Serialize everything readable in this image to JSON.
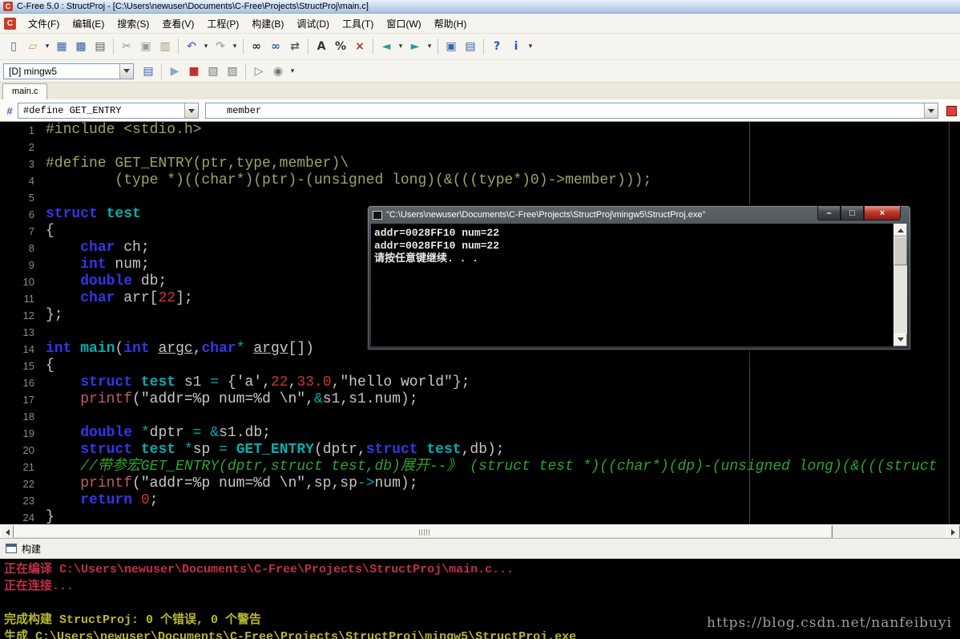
{
  "window": {
    "title": "C-Free 5.0 : StructProj - [C:\\Users\\newuser\\Documents\\C-Free\\Projects\\StructProj\\main.c]",
    "app_icon": "C"
  },
  "menu": {
    "items": [
      {
        "key": "file",
        "label": "文件(F)"
      },
      {
        "key": "edit",
        "label": "编辑(E)"
      },
      {
        "key": "search",
        "label": "搜索(S)"
      },
      {
        "key": "view",
        "label": "查看(V)"
      },
      {
        "key": "project",
        "label": "工程(P)"
      },
      {
        "key": "build",
        "label": "构建(B)"
      },
      {
        "key": "debug",
        "label": "调试(D)"
      },
      {
        "key": "tools",
        "label": "工具(T)"
      },
      {
        "key": "window",
        "label": "窗口(W)"
      },
      {
        "key": "help",
        "label": "帮助(H)"
      }
    ]
  },
  "toolbar1": {
    "items": [
      {
        "name": "new-file-icon",
        "glyph": "▯",
        "color": "#4A5E86"
      },
      {
        "name": "open-file-icon",
        "glyph": "▱",
        "color": "#C79A3B"
      },
      {
        "name": "open-file-dropdown",
        "glyph": "▾",
        "color": "#333333",
        "small": true
      },
      {
        "name": "save-icon",
        "glyph": "▦",
        "color": "#3A62B0"
      },
      {
        "name": "save-all-icon",
        "glyph": "▩",
        "color": "#3A62B0"
      },
      {
        "name": "print-icon",
        "glyph": "▤",
        "color": "#5A5A5A"
      },
      {
        "sep": true
      },
      {
        "name": "cut-icon",
        "glyph": "✂",
        "color": "#9A9A9A"
      },
      {
        "name": "copy-icon",
        "glyph": "▣",
        "color": "#9A9A9A"
      },
      {
        "name": "paste-icon",
        "glyph": "▥",
        "color": "#A89A6A"
      },
      {
        "sep": true
      },
      {
        "name": "undo-icon",
        "glyph": "↶",
        "color": "#7B68C8"
      },
      {
        "name": "undo-dropdown",
        "glyph": "▾",
        "color": "#333333",
        "small": true
      },
      {
        "name": "redo-icon",
        "glyph": "↷",
        "color": "#ABABAB"
      },
      {
        "name": "redo-dropdown",
        "glyph": "▾",
        "color": "#333333",
        "small": true
      },
      {
        "sep": true
      },
      {
        "name": "find-icon",
        "glyph": "∞",
        "color": "#2F2F2F"
      },
      {
        "name": "find-in-files-icon",
        "glyph": "∞",
        "color": "#2F5FA0"
      },
      {
        "name": "replace-icon",
        "glyph": "⇄",
        "color": "#5A5A5A"
      },
      {
        "sep": true
      },
      {
        "name": "font-icon",
        "glyph": "A",
        "color": "#333333"
      },
      {
        "name": "zoom-icon",
        "glyph": "%",
        "color": "#333333"
      },
      {
        "name": "close-file-icon",
        "glyph": "×",
        "color": "#B03030"
      },
      {
        "sep": true
      },
      {
        "name": "navigate-back-icon",
        "glyph": "◄",
        "color": "#2E9A9A"
      },
      {
        "name": "navigate-back-dropdown",
        "glyph": "▾",
        "color": "#333333",
        "small": true
      },
      {
        "name": "navigate-forward-icon",
        "glyph": "►",
        "color": "#2E9A9A"
      },
      {
        "name": "navigate-forward-dropdown",
        "glyph": "▾",
        "color": "#333333",
        "small": true
      },
      {
        "sep": true
      },
      {
        "name": "new-window-icon",
        "glyph": "▣",
        "color": "#3A62B0"
      },
      {
        "name": "window-list-icon",
        "glyph": "▤",
        "color": "#3A62B0"
      },
      {
        "sep": true
      },
      {
        "name": "help-icon",
        "glyph": "?",
        "color": "#1A5ACB"
      },
      {
        "name": "about-icon",
        "glyph": "i",
        "color": "#1A5ACB"
      },
      {
        "name": "toolbar-overflow-dropdown",
        "glyph": "▾",
        "color": "#333333",
        "small": true
      }
    ]
  },
  "toolbar2": {
    "config": "[D] mingw5",
    "items": [
      {
        "name": "check-syntax-icon",
        "glyph": "▤",
        "color": "#3A62B0"
      },
      {
        "sep": true
      },
      {
        "name": "run-icon",
        "glyph": "▶",
        "color": "#8AA8C4"
      },
      {
        "name": "stop-icon",
        "glyph": "■",
        "color": "#C03030"
      },
      {
        "name": "compile-icon",
        "glyph": "▧",
        "color": "#777777"
      },
      {
        "name": "build-icon",
        "glyph": "▨",
        "color": "#777777"
      },
      {
        "sep": true
      },
      {
        "name": "debug-icon",
        "glyph": "▷",
        "color": "#777777"
      },
      {
        "name": "breakpoint-icon",
        "glyph": "◉",
        "color": "#777777"
      },
      {
        "name": "build-toolbar-dropdown",
        "glyph": "▾",
        "color": "#333333",
        "small": true
      }
    ]
  },
  "tabs": [
    {
      "label": "main.c"
    }
  ],
  "navbar": {
    "symbol_icon": "#",
    "symbol": "#define GET_ENTRY",
    "member": "member"
  },
  "editor": {
    "lines": [
      {
        "n": 1,
        "t": [
          [
            "#include <stdio.h>",
            "pre"
          ]
        ]
      },
      {
        "n": 2,
        "t": []
      },
      {
        "n": 3,
        "t": [
          [
            "#define GET_ENTRY(ptr,type,member)\\",
            "pre"
          ]
        ]
      },
      {
        "n": 4,
        "t": [
          [
            "        (type *)((char*)(ptr)-(unsigned long)(&(((type*)0)->member)));",
            "pre"
          ]
        ]
      },
      {
        "n": 5,
        "t": []
      },
      {
        "n": 6,
        "t": [
          [
            "struct",
            "kw"
          ],
          [
            " ",
            "pl"
          ],
          [
            "test",
            "type"
          ]
        ]
      },
      {
        "n": 7,
        "t": [
          [
            "{",
            "pl"
          ]
        ]
      },
      {
        "n": 8,
        "t": [
          [
            "    ",
            "pl"
          ],
          [
            "char",
            "kw"
          ],
          [
            " ch;",
            "pl"
          ]
        ]
      },
      {
        "n": 9,
        "t": [
          [
            "    ",
            "pl"
          ],
          [
            "int",
            "kw"
          ],
          [
            " num;",
            "pl"
          ]
        ]
      },
      {
        "n": 10,
        "t": [
          [
            "    ",
            "pl"
          ],
          [
            "double",
            "kw"
          ],
          [
            " db;",
            "pl"
          ]
        ]
      },
      {
        "n": 11,
        "t": [
          [
            "    ",
            "pl"
          ],
          [
            "char",
            "kw"
          ],
          [
            " arr[",
            "pl"
          ],
          [
            "22",
            "num"
          ],
          [
            "];",
            "pl"
          ]
        ]
      },
      {
        "n": 12,
        "t": [
          [
            "};",
            "pl"
          ]
        ]
      },
      {
        "n": 13,
        "t": []
      },
      {
        "n": 14,
        "t": [
          [
            "int",
            "kw"
          ],
          [
            " ",
            "pl"
          ],
          [
            "main",
            "type"
          ],
          [
            "(",
            "pl"
          ],
          [
            "int",
            "kw"
          ],
          [
            " ",
            "pl"
          ],
          [
            "argc",
            "arg"
          ],
          [
            ",",
            "pl"
          ],
          [
            "char",
            "kw"
          ],
          [
            "*",
            "op"
          ],
          [
            " ",
            "pl"
          ],
          [
            "argv",
            "arg"
          ],
          [
            "[])",
            "pl"
          ]
        ]
      },
      {
        "n": 15,
        "t": [
          [
            "{",
            "pl"
          ]
        ]
      },
      {
        "n": 16,
        "t": [
          [
            "    ",
            "pl"
          ],
          [
            "struct",
            "kw"
          ],
          [
            " ",
            "pl"
          ],
          [
            "test",
            "type"
          ],
          [
            " s1 ",
            "pl"
          ],
          [
            "=",
            "op"
          ],
          [
            " {",
            "pl"
          ],
          [
            "'a'",
            "str"
          ],
          [
            ",",
            "pl"
          ],
          [
            "22",
            "num"
          ],
          [
            ",",
            "pl"
          ],
          [
            "33.0",
            "num"
          ],
          [
            ",",
            "pl"
          ],
          [
            "\"hello world\"",
            "str"
          ],
          [
            "};",
            "pl"
          ]
        ]
      },
      {
        "n": 17,
        "t": [
          [
            "    ",
            "pl"
          ],
          [
            "printf",
            "fn"
          ],
          [
            "(",
            "pl"
          ],
          [
            "\"addr=%p num=%d \\n\"",
            "str"
          ],
          [
            ",",
            "pl"
          ],
          [
            "&",
            "op"
          ],
          [
            "s1,s1.num);",
            "pl"
          ]
        ]
      },
      {
        "n": 18,
        "t": []
      },
      {
        "n": 19,
        "t": [
          [
            "    ",
            "pl"
          ],
          [
            "double",
            "kw"
          ],
          [
            " ",
            "pl"
          ],
          [
            "*",
            "op"
          ],
          [
            "dptr ",
            "pl"
          ],
          [
            "=",
            "op"
          ],
          [
            " ",
            "pl"
          ],
          [
            "&",
            "op"
          ],
          [
            "s1.db;",
            "pl"
          ]
        ]
      },
      {
        "n": 20,
        "t": [
          [
            "    ",
            "pl"
          ],
          [
            "struct",
            "kw"
          ],
          [
            " ",
            "pl"
          ],
          [
            "test",
            "type"
          ],
          [
            " ",
            "pl"
          ],
          [
            "*",
            "op"
          ],
          [
            "sp ",
            "pl"
          ],
          [
            "=",
            "op"
          ],
          [
            " ",
            "pl"
          ],
          [
            "GET_ENTRY",
            "type"
          ],
          [
            "(dptr,",
            "pl"
          ],
          [
            "struct",
            "kw"
          ],
          [
            " ",
            "pl"
          ],
          [
            "test",
            "type"
          ],
          [
            ",db);",
            "pl"
          ]
        ]
      },
      {
        "n": 21,
        "t": [
          [
            "    //带参宏GET_ENTRY(dptr,struct test,db)展开--》 (struct test *)((char*)(dp)-(unsigned long)(&(((struct",
            "com"
          ]
        ]
      },
      {
        "n": 22,
        "t": [
          [
            "    ",
            "pl"
          ],
          [
            "printf",
            "fn"
          ],
          [
            "(",
            "pl"
          ],
          [
            "\"addr=%p num=%d \\n\"",
            "str"
          ],
          [
            ",sp,sp",
            "pl"
          ],
          [
            "->",
            "op"
          ],
          [
            "num);",
            "pl"
          ]
        ]
      },
      {
        "n": 23,
        "t": [
          [
            "    ",
            "pl"
          ],
          [
            "return",
            "kw"
          ],
          [
            " ",
            "pl"
          ],
          [
            "0",
            "num"
          ],
          [
            ";",
            "pl"
          ]
        ]
      },
      {
        "n": 24,
        "t": [
          [
            "}",
            "pl"
          ]
        ]
      }
    ]
  },
  "console": {
    "title": "\"C:\\Users\\newuser\\Documents\\C-Free\\Projects\\StructProj\\mingw5\\StructProj.exe\"",
    "lines": [
      "addr=0028FF10 num=22",
      "addr=0028FF10 num=22",
      "请按任意键继续. . ."
    ],
    "buttons": [
      {
        "name": "console-minimize-button",
        "glyph": "–",
        "style": "min"
      },
      {
        "name": "console-maximize-button",
        "glyph": "□",
        "style": "max"
      },
      {
        "name": "console-close-button",
        "glyph": "×",
        "style": "close"
      }
    ]
  },
  "build": {
    "header": "构建",
    "lines": [
      {
        "text": "正在编译 C:\\Users\\newuser\\Documents\\C-Free\\Projects\\StructProj\\main.c...",
        "color": "red"
      },
      {
        "text": "正在连接...",
        "color": "red"
      },
      {
        "text": "",
        "color": "red"
      },
      {
        "text": "完成构建 StructProj: 0 个错误, 0 个警告",
        "color": "yellow"
      },
      {
        "text": "生成 C:\\Users\\newuser\\Documents\\C-Free\\Projects\\StructProj\\mingw5\\StructProj.exe",
        "color": "yellow"
      }
    ]
  },
  "watermark": "https://blog.csdn.net/nanfeibuyi"
}
